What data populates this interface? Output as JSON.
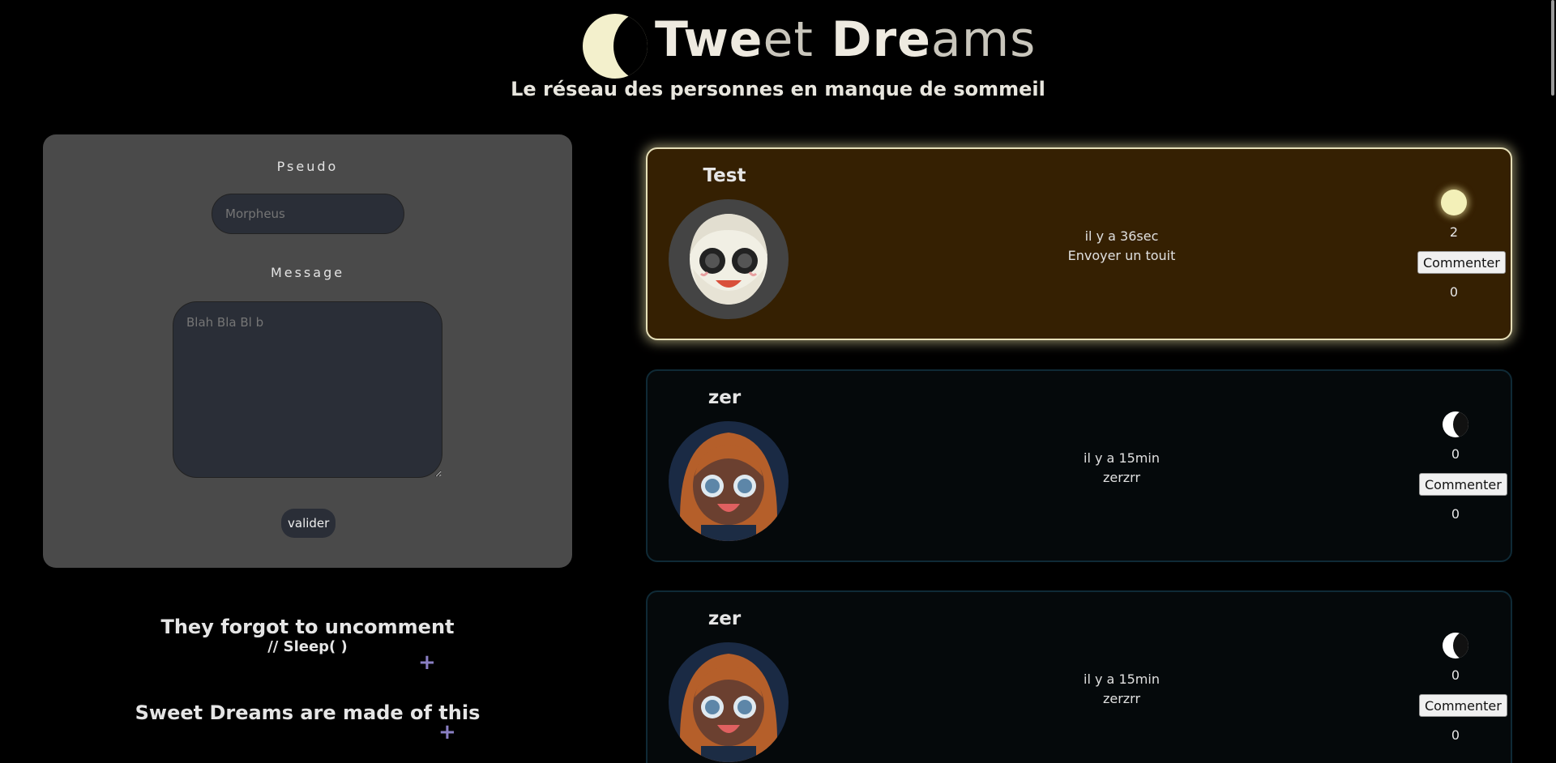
{
  "header": {
    "title_part1": "Twe",
    "title_part2": "et",
    "title_part3": " Dre",
    "title_part4": "a",
    "title_part5": "ms",
    "subtitle": "Le réseau des personnes en manque de sommeil",
    "logo_icon": "crescent-moon-icon"
  },
  "form": {
    "pseudo_label": "Pseudo",
    "pseudo_placeholder": "Morpheus",
    "message_label": "Message",
    "message_placeholder": "Blah Bla Bl b",
    "submit_label": "valider"
  },
  "sidebar": {
    "items": [
      {
        "title": "They forgot to uncomment",
        "code": "// Sleep( )",
        "icon": "plus-icon"
      },
      {
        "title": "Sweet Dreams are made of this",
        "icon": "plus-icon"
      }
    ]
  },
  "feed": {
    "posts": [
      {
        "user": "Test",
        "time": "il y a 36sec",
        "message": "Envoyer un touit",
        "likes": "2",
        "comment_label": "Commenter",
        "comments": "0",
        "like_icon": "full-moon-icon",
        "highlighted": true
      },
      {
        "user": "zer",
        "time": "il y a 15min",
        "message": "zerzrr",
        "likes": "0",
        "comment_label": "Commenter",
        "comments": "0",
        "like_icon": "crescent-moon-icon",
        "highlighted": false
      },
      {
        "user": "zer",
        "time": "il y a 15min",
        "message": "zerzrr",
        "likes": "0",
        "comment_label": "Commenter",
        "comments": "0",
        "like_icon": "crescent-moon-icon",
        "highlighted": false
      }
    ]
  }
}
